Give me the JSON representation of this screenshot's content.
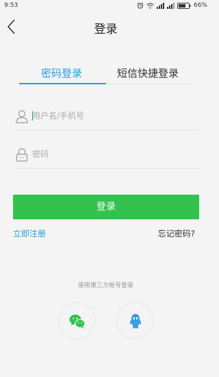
{
  "status_bar": {
    "time": "9:53",
    "battery": "66%"
  },
  "header": {
    "title": "登录"
  },
  "tabs": {
    "password_login": "密码登录",
    "sms_login": "短信快捷登录"
  },
  "form": {
    "username_placeholder": "用户名/手机号",
    "password_placeholder": "密码",
    "login_button": "登录",
    "register_link": "立即注册",
    "forgot_link": "忘记密码?"
  },
  "third_party": {
    "label": "使用第三方帐号登录",
    "providers": [
      "wechat-icon",
      "qq-icon"
    ]
  },
  "colors": {
    "accent": "#20a0e0",
    "primary_button": "#33c24d",
    "background": "#f4f4f4"
  }
}
